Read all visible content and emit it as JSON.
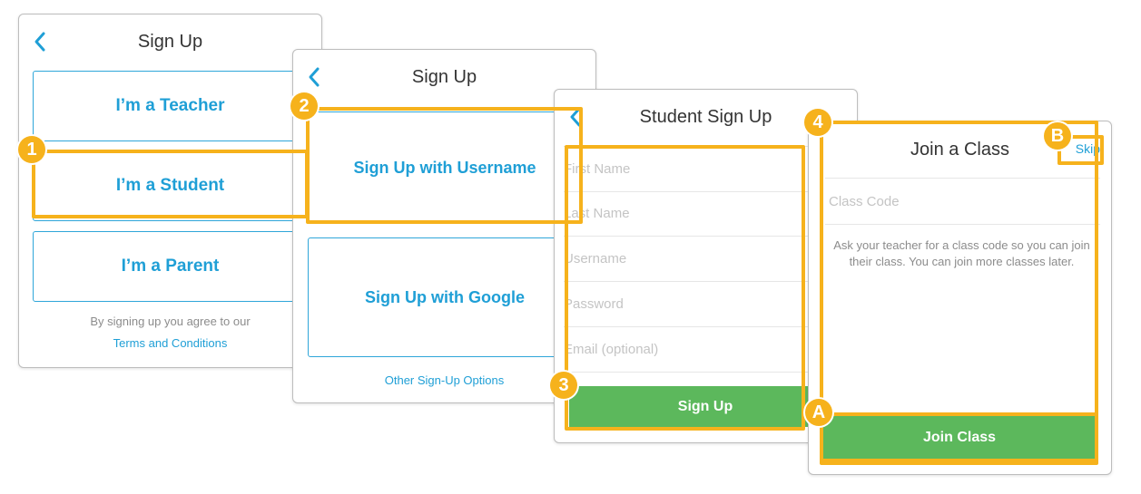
{
  "screen1": {
    "title": "Sign Up",
    "teacher_label": "I’m a Teacher",
    "student_label": "I’m a Student",
    "parent_label": "I’m a Parent",
    "agree_text": "By signing up you agree to our",
    "terms_link": "Terms and Conditions"
  },
  "screen2": {
    "title": "Sign Up",
    "username_label": "Sign Up with Username",
    "google_label": "Sign Up with Google",
    "other_link": "Other Sign-Up Options"
  },
  "screen3": {
    "title": "Student Sign Up",
    "fields": {
      "first_name": "First Name",
      "last_name": "Last Name",
      "username": "Username",
      "password": "Password",
      "email": "Email (optional)"
    },
    "submit_label": "Sign Up"
  },
  "screen4": {
    "title": "Join a Class",
    "skip_label": "Skip",
    "class_code_placeholder": "Class Code",
    "help_text": "Ask your teacher for a class code so you can join their class. You can join more classes later.",
    "join_label": "Join Class"
  },
  "callouts": {
    "step1": "1",
    "step2": "2",
    "step3": "3",
    "step4": "4",
    "stepA": "A",
    "stepB": "B"
  },
  "colors": {
    "accent": "#1f9fd6",
    "highlight": "#f6b21c",
    "button_green": "#5cb85c",
    "placeholder": "#c4c4c4"
  },
  "icons": {
    "back": "chevron-left-icon"
  }
}
